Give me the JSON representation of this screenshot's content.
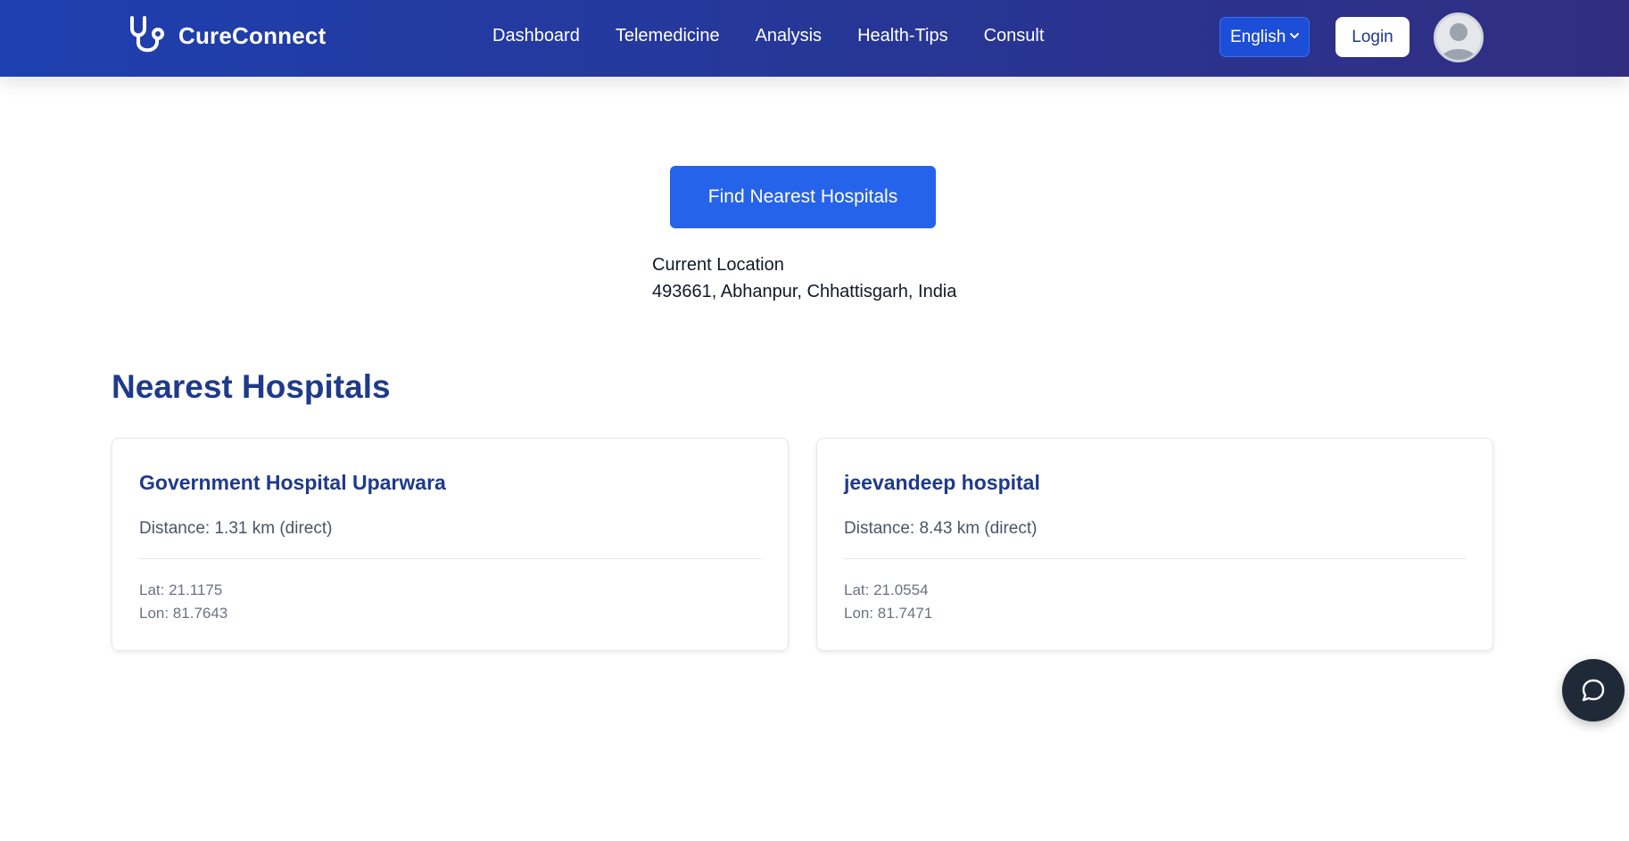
{
  "navbar": {
    "brand": {
      "name": "CureConnect",
      "icon": "stethoscope-icon"
    },
    "links": [
      "Dashboard",
      "Telemedicine",
      "Analysis",
      "Health-Tips",
      "Consult"
    ],
    "language": {
      "selected": "English",
      "icon": "chevron-down-icon"
    },
    "login_label": "Login",
    "avatar_icon": "user-avatar-icon"
  },
  "main": {
    "find_button_label": "Find Nearest Hospitals",
    "location": {
      "label": "Current Location",
      "value": "493661, Abhanpur, Chhattisgarh, India"
    },
    "section_title": "Nearest Hospitals",
    "hospitals": [
      {
        "name": "Government Hospital Uparwara",
        "distance": "Distance: 1.31 km (direct)",
        "lat": "Lat: 21.1175",
        "lon": "Lon: 81.7643"
      },
      {
        "name": "jeevandeep hospital",
        "distance": "Distance: 8.43 km (direct)",
        "lat": "Lat: 21.0554",
        "lon": "Lon: 81.7471"
      }
    ]
  },
  "chat_button": {
    "icon": "chat-bubble-icon"
  },
  "colors": {
    "nav_gradient_start": "#1e40af",
    "nav_gradient_end": "#312e81",
    "primary_button": "#2563eb",
    "heading": "#1e3a8a",
    "chat_fab": "#1f2937"
  }
}
